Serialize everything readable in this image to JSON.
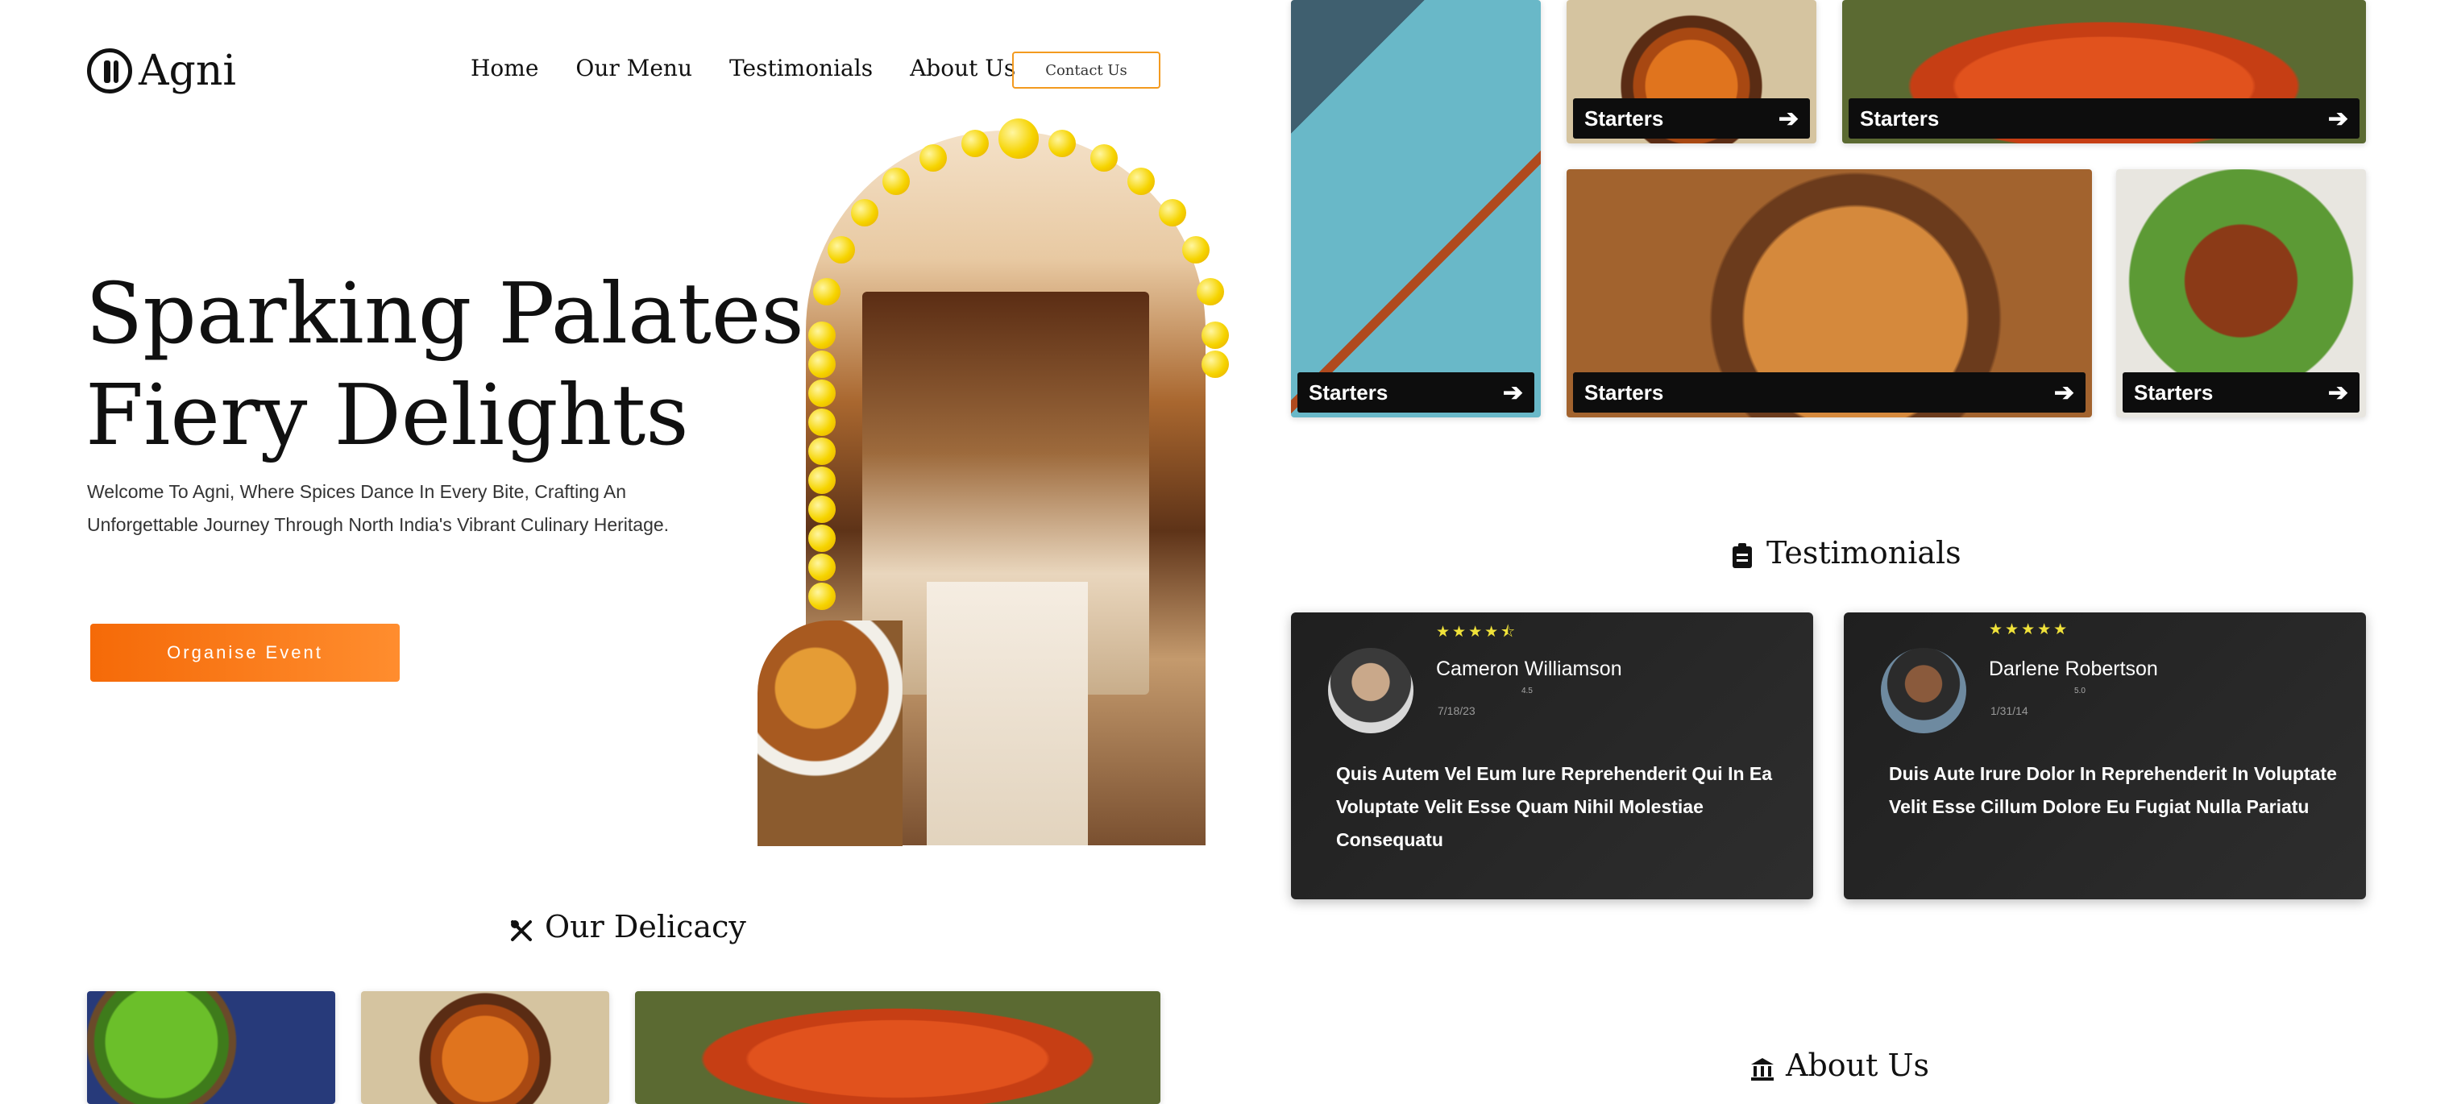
{
  "brand": {
    "name": "Agni"
  },
  "nav": {
    "items": [
      "Home",
      "Our Menu",
      "Testimonials",
      "About Us"
    ],
    "contact_label": "Contact Us"
  },
  "hero": {
    "title_line1": "Sparking Palates,",
    "title_line2": "Fiery Delights",
    "subtitle": "Welcome To Agni, Where Spices Dance In Every Bite, Crafting An Unforgettable Journey Through North India's Vibrant Culinary Heritage.",
    "cta_label": "Organise Event"
  },
  "delicacy": {
    "title": "Our Delicacy"
  },
  "menu_tiles": [
    {
      "label": "Starters"
    },
    {
      "label": "Starters"
    },
    {
      "label": "Starters"
    },
    {
      "label": "Starters"
    },
    {
      "label": "Starters"
    },
    {
      "label": "Starters"
    }
  ],
  "testimonials": {
    "title": "Testimonials",
    "items": [
      {
        "name": "Cameron Williamson",
        "stars": "★★★★⯪",
        "rating": "4.5",
        "date": "7/18/23",
        "quote": "Quis Autem Vel Eum Iure Reprehenderit Qui In Ea Voluptate Velit Esse Quam Nihil Molestiae Consequatu"
      },
      {
        "name": "Darlene Robertson",
        "stars": "★★★★★",
        "rating": "5.0",
        "date": "1/31/14",
        "quote": "Duis Aute Irure Dolor In Reprehenderit In Voluptate Velit Esse Cillum Dolore Eu Fugiat Nulla Pariatu"
      }
    ]
  },
  "about": {
    "title": "About Us"
  },
  "colors": {
    "accent": "#f56a08",
    "contact_border": "#f39a1f",
    "card_bg": "#242424",
    "star": "#f0e23a"
  }
}
